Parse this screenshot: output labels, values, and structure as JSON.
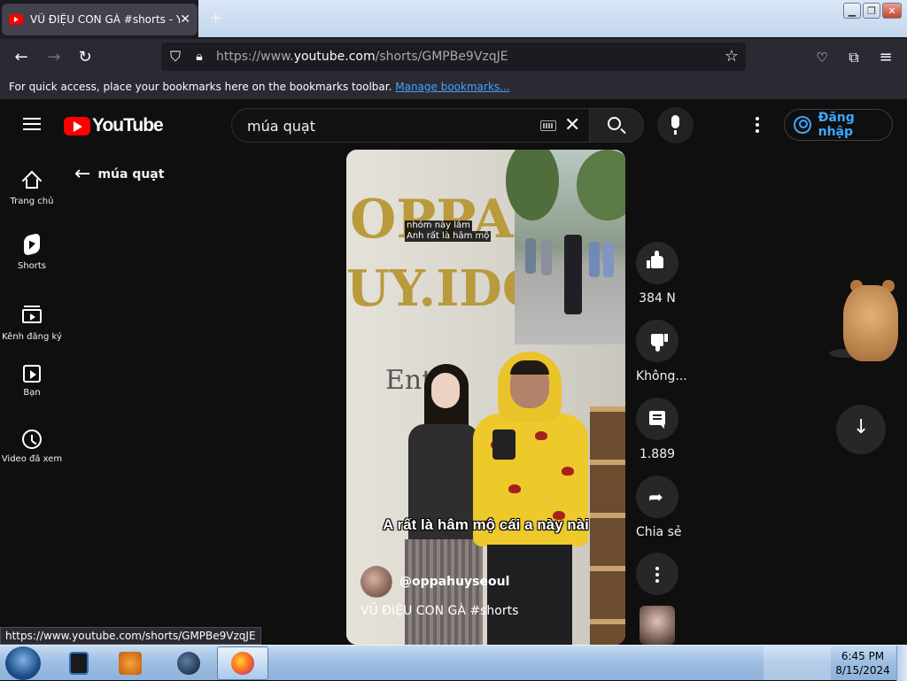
{
  "browser": {
    "tab_title": "VŨ ĐIỆU CON GÀ #shorts - You",
    "tab_close": "✕",
    "new_tab": "+",
    "url_prefix": "https://www.",
    "url_domain": "youtube.com",
    "url_path": "/shorts/GMPBe9VzqJE",
    "bookmark_text": "For quick access, place your bookmarks here on the bookmarks toolbar.",
    "bookmark_link": "Manage bookmarks...",
    "status_url": "https://www.youtube.com/shorts/GMPBe9VzqJE"
  },
  "youtube": {
    "logo_text": "YouTube",
    "search_value": "múa quạt",
    "signin_label": "Đăng nhập",
    "back_label": "múa quạt",
    "sidebar": [
      {
        "label": "Trang chủ",
        "icon": "home-icon"
      },
      {
        "label": "Shorts",
        "icon": "shorts-icon"
      },
      {
        "label": "Kênh đăng ký",
        "icon": "subscriptions-icon"
      },
      {
        "label": "Bạn",
        "icon": "you-icon"
      },
      {
        "label": "Video đã xem",
        "icon": "history-icon"
      }
    ],
    "video": {
      "sign_top": "OPPA",
      "sign_mid": "UY.IDO",
      "sign_low": "Ent",
      "caption_small_1": "nhóm này lắm",
      "caption_small_2": "Anh rất là hâm mộ",
      "caption_big": "A rất là hâm mộ cái a này nài",
      "channel_handle": "@oppahuyseoul",
      "title": "VŨ ĐIỆU CON GÀ #shorts"
    },
    "actions": {
      "likes": "384 N",
      "dislike_label": "Không...",
      "comments": "1.889",
      "share_label": "Chia sẻ"
    }
  },
  "taskbar": {
    "time": "6:45 PM",
    "date": "8/15/2024"
  },
  "colors": {
    "brand_red": "#ff0000",
    "link_blue": "#3ea6ff",
    "background": "#0f0f0f"
  }
}
